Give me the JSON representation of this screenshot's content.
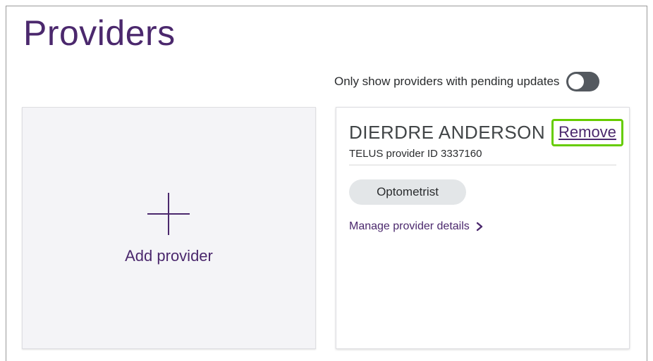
{
  "page": {
    "title": "Providers"
  },
  "filter": {
    "label": "Only show providers with pending updates",
    "toggle_on": false
  },
  "add_card": {
    "label": "Add provider"
  },
  "provider": {
    "name": "DIERDRE ANDERSON",
    "remove_label": "Remove",
    "id_text": "TELUS provider ID 3337160",
    "tag": "Optometrist",
    "manage_label": "Manage provider details"
  },
  "colors": {
    "brand": "#4b286d",
    "focus": "#66cc00",
    "toggle_off": "#54595f"
  }
}
